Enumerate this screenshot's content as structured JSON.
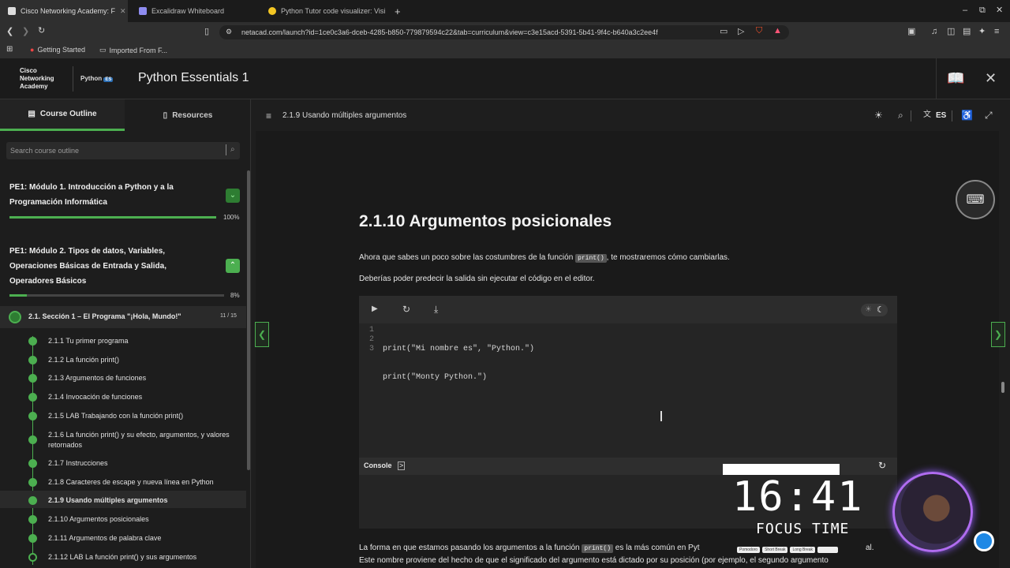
{
  "browser": {
    "tabs": [
      {
        "title": "Cisco Networking Academy: F",
        "active": true
      },
      {
        "title": "Excalidraw Whiteboard",
        "active": false
      },
      {
        "title": "Python Tutor code visualizer: Visi",
        "active": false
      }
    ],
    "new_tab": "+",
    "url": "netacad.com/launch?id=1ce0c3a6-dceb-4285-b850-779879594c22&tab=curriculum&view=c3e15acd-5391-5b41-9f4c-b640a3c2ee4f",
    "bookmarks": [
      "Getting Started",
      "Imported From F..."
    ],
    "window_controls": {
      "min": "–",
      "restore": "⧉",
      "close": "✕"
    }
  },
  "app": {
    "logo_text": [
      "Cisco",
      "Networking",
      "Academy"
    ],
    "python_badge": "Python",
    "python_badge_suffix": "ES",
    "title": "Python Essentials 1"
  },
  "sidebar": {
    "tabs": [
      "Course Outline",
      "Resources"
    ],
    "search_placeholder": "Search course outline",
    "modules": [
      {
        "lines": [
          "PE1: Módulo 1. Introducción a Python y a la",
          "Programación Informática"
        ],
        "pct": "100%",
        "progress": 1.0
      },
      {
        "lines": [
          "PE1: Módulo 2. Tipos de datos, Variables,",
          "Operaciones Básicas de Entrada y Salida,",
          "Operadores Básicos"
        ],
        "pct": "8%",
        "progress": 0.08
      }
    ],
    "section": {
      "title": "2.1. Sección 1 – El Programa \"¡Hola, Mundo!\"",
      "count": "11 / 15"
    },
    "lessons": [
      "2.1.1 Tu primer programa",
      "2.1.2 La función print()",
      "2.1.3 Argumentos de funciones",
      "2.1.4 Invocación de funciones",
      "2.1.5 LAB Trabajando con la función print()",
      "2.1.6 La función print() y su efecto, argumentos, y valores",
      "retornados",
      "2.1.7 Instrucciones",
      "2.1.8 Caracteres de escape y nueva línea en Python",
      "2.1.9 Usando múltiples argumentos",
      "2.1.10 Argumentos posicionales",
      "2.1.11 Argumentos de palabra clave",
      "2.1.12 LAB La función print() y sus argumentos"
    ]
  },
  "topbar": {
    "breadcrumb": "2.1.9 Usando múltiples argumentos",
    "lang": "ES"
  },
  "article": {
    "heading": "2.1.10 Argumentos posicionales",
    "p1_before": "Ahora que sabes un poco sobre las costumbres de la función ",
    "p1_code": "print()",
    "p1_after": ", te mostraremos cómo cambiarlas.",
    "p2": "Deberías poder predecir la salida sin ejecutar el código en el editor.",
    "p3_before": "La forma en que estamos pasando los argumentos a la función ",
    "p3_code": "print()",
    "p3_after": " es la más común en Pyt",
    "p3_end": "al.",
    "p4": "Este nombre proviene del hecho de que el significado del argumento está dictado por su posición (por ejemplo, el segundo argumento"
  },
  "editor": {
    "line_numbers": [
      "1",
      "2",
      "3"
    ],
    "lines": [
      "print(\"Mi nombre es\", \"Python.\")",
      "print(\"Monty Python.\")",
      ""
    ],
    "console_label": "Console"
  },
  "overlay": {
    "timer": "16:41",
    "mode": "FOCUS TIME",
    "mini_tabs": [
      "Pomodoro",
      "Short Break",
      "Long Break"
    ]
  },
  "colors": {
    "accent_green": "#4caf50",
    "link_blue": "#2196f3"
  }
}
